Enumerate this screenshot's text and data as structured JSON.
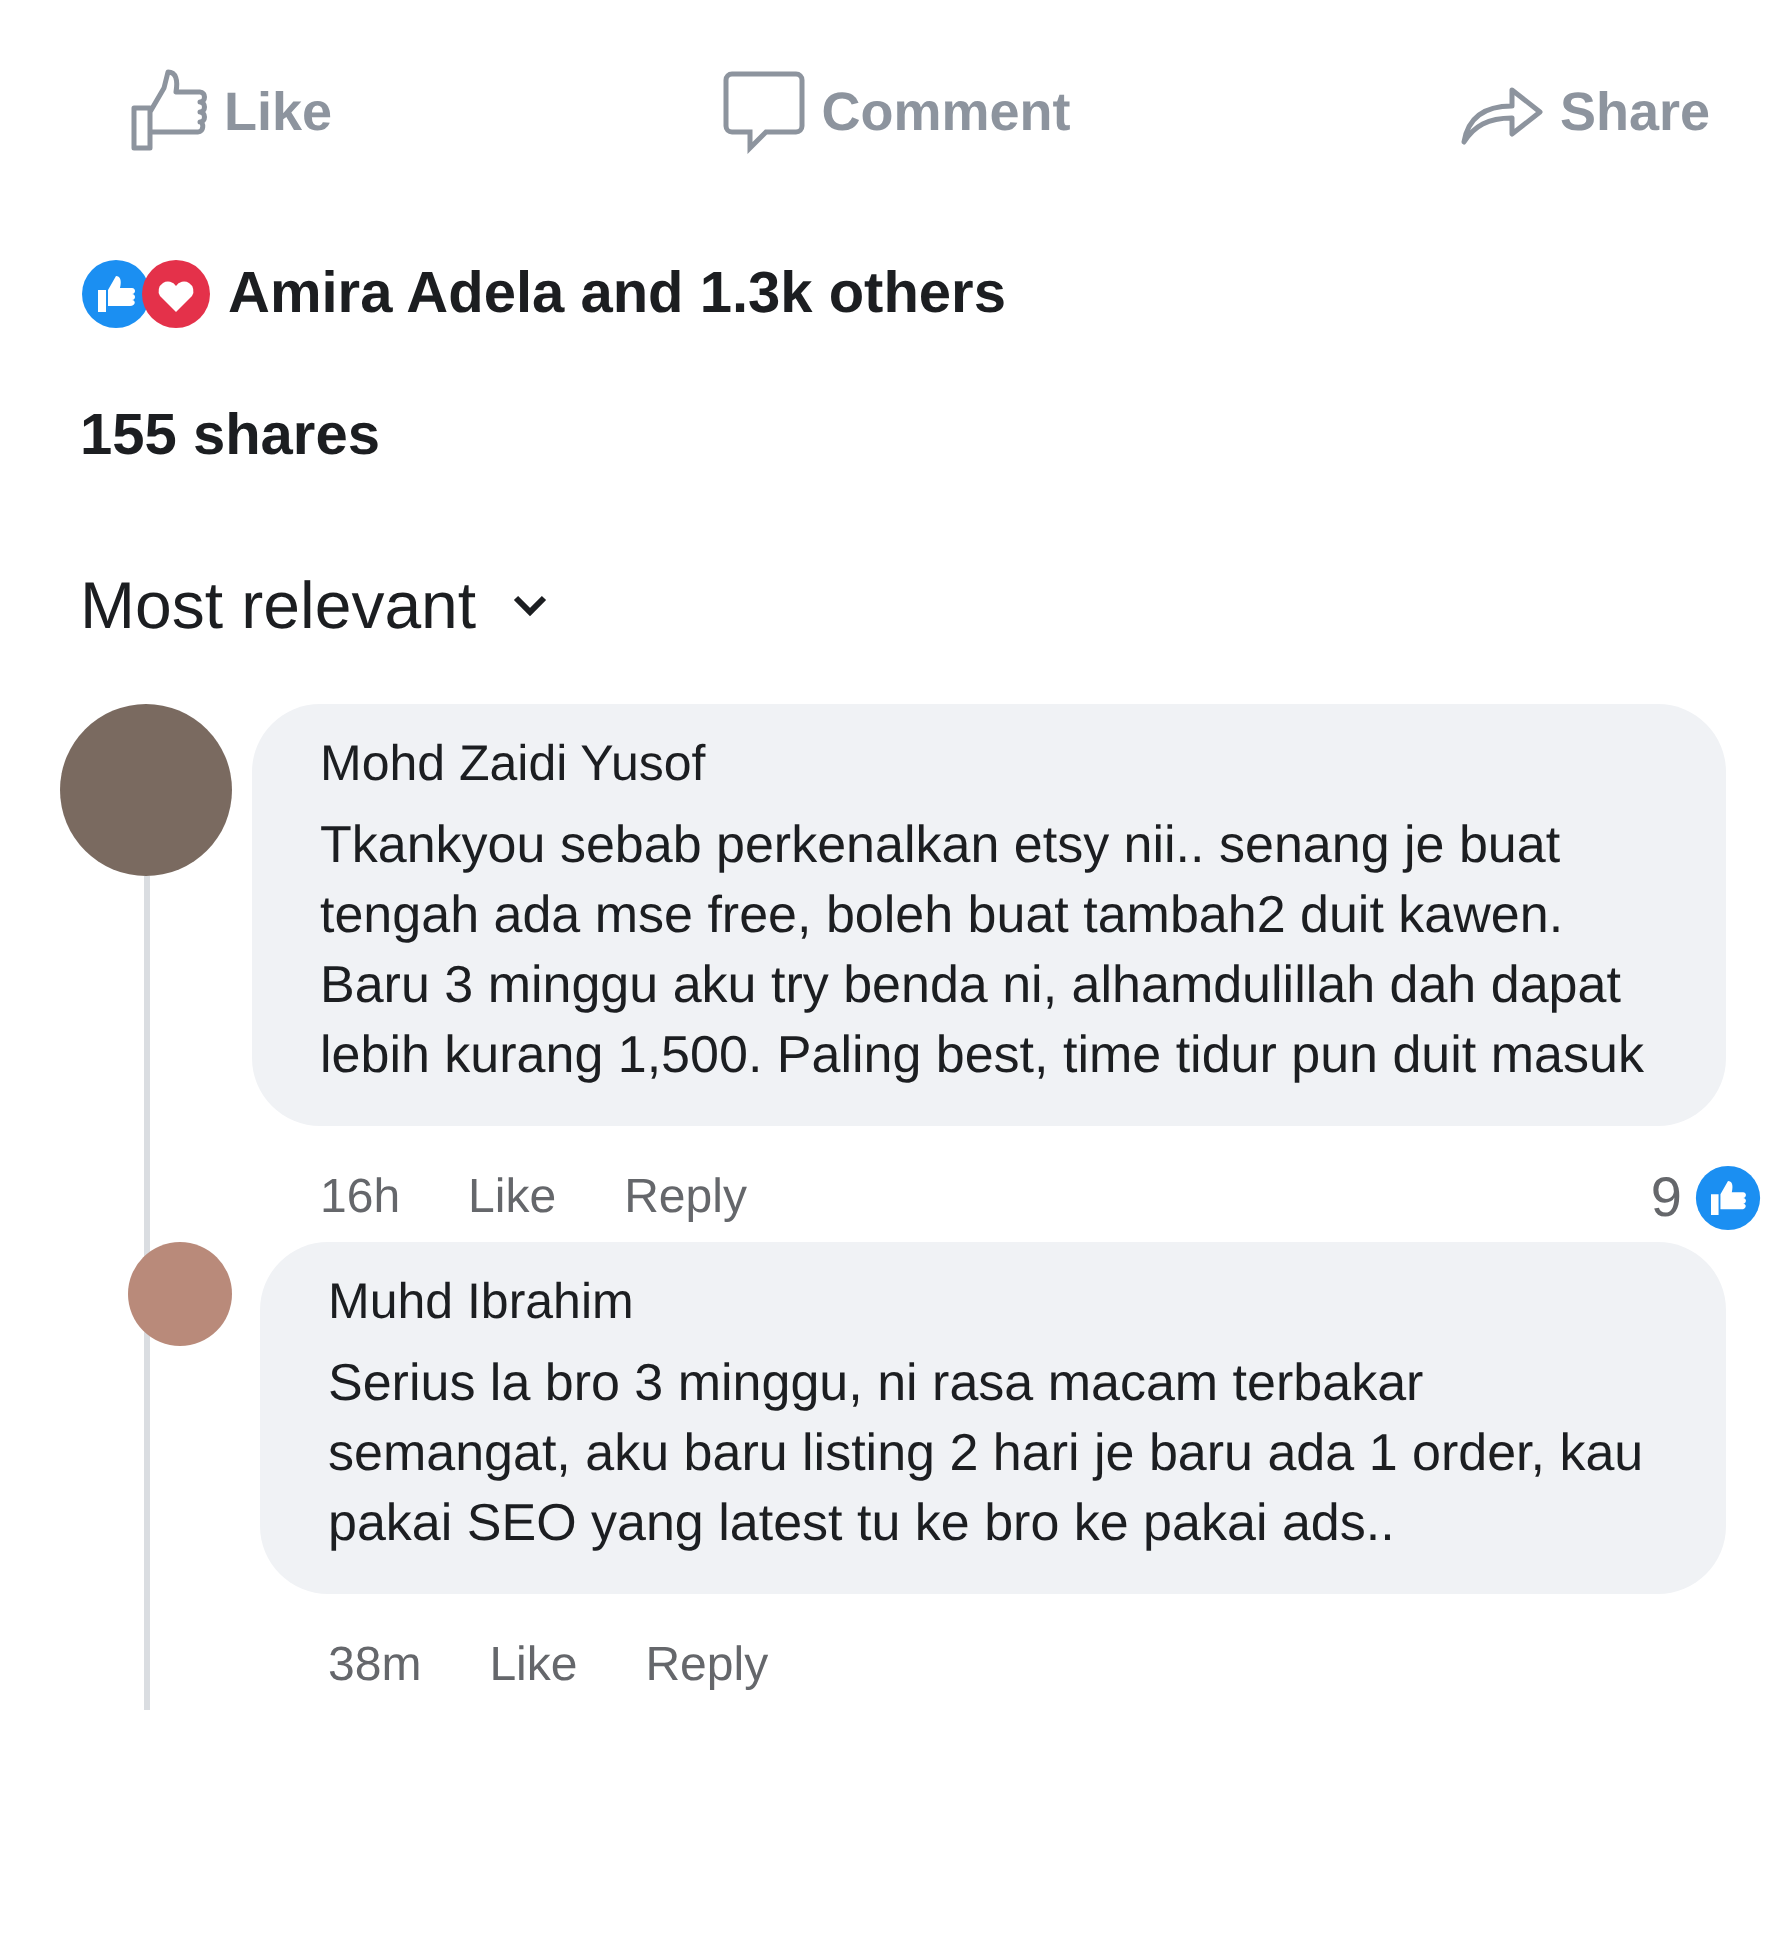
{
  "actions": [
    {
      "kind": "like",
      "label": "Like"
    },
    {
      "kind": "comment",
      "label": "Comment"
    },
    {
      "kind": "share",
      "label": "Share"
    }
  ],
  "reactions": {
    "text": "Amira Adela and 1.3k others"
  },
  "shares": "155 shares",
  "sort": {
    "label": "Most relevant"
  },
  "comments": [
    {
      "author": "Mohd Zaidi Yusof",
      "text": "Tkankyou sebab perkenalkan etsy nii.. senang je buat tengah ada mse free, boleh buat tambah2 duit kawen. Baru 3 minggu aku try benda ni, alhamdulillah dah dapat lebih kurang 1,500. Paling best, time tidur pun duit masuk",
      "time": "16h",
      "like": "Like",
      "reply": "Reply",
      "like_count": "9",
      "children": [
        {
          "author": "Muhd Ibrahim",
          "text": "Serius la bro 3 minggu, ni rasa macam terbakar semangat, aku baru listing 2 hari je baru ada 1 order, kau pakai SEO yang latest tu ke bro ke pakai ads..",
          "time": "38m",
          "like": "Like",
          "reply": "Reply"
        }
      ]
    }
  ]
}
